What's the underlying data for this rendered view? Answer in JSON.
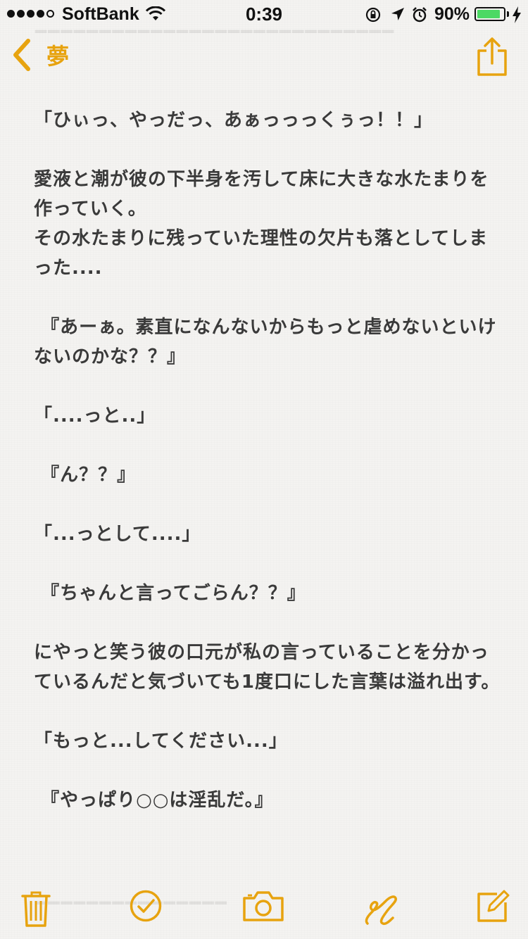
{
  "status_bar": {
    "carrier": "SoftBank",
    "time": "0:39",
    "battery_percent": "90%",
    "battery_level": 0.9,
    "icons": [
      "signal-dots",
      "wifi-icon",
      "orientation-lock-icon",
      "location-arrow-icon",
      "alarm-icon",
      "battery-icon",
      "charging-bolt-icon"
    ]
  },
  "nav": {
    "back_label": "夢",
    "back_icon": "chevron-left-icon",
    "share_icon": "share-icon"
  },
  "accent_color": "#e7a30f",
  "note": {
    "lines": [
      "「ひぃっ、やっだっ、あぁっっっくぅっ！！」",
      "",
      "愛液と潮が彼の下半身を汚して床に大きな水たまりを",
      "作っていく。",
      "その水たまりに残っていた理性の欠片も落としてしま",
      "った....",
      "",
      " 『あーぁ。素直になんないからもっと虐めないといけ",
      "ないのかな？？』",
      "",
      "「....っと..」",
      "",
      " 『ん？？』",
      "",
      "「...っとして....」",
      "",
      " 『ちゃんと言ってごらん？？』",
      "",
      "にやっと笑う彼の口元が私の言っていることを分かっ",
      "ているんだと気づいても1度口にした言葉は溢れ出す。",
      "",
      "「もっと...してください...」",
      "",
      " 『やっぱり○○は淫乱だ。』"
    ]
  },
  "toolbar": {
    "icons": [
      "trash-icon",
      "checklist-icon",
      "camera-icon",
      "sketch-icon",
      "compose-icon"
    ]
  }
}
